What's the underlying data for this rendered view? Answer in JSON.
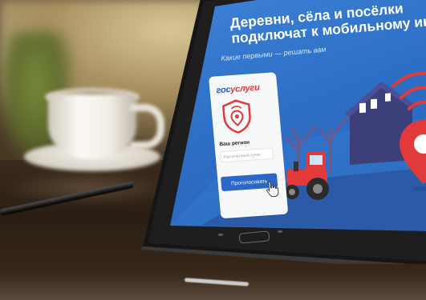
{
  "screen": {
    "headline_line1": "Деревни, сёла и посёлки",
    "headline_line2": "подключат к мобильному интернету",
    "subline": "Какие первыми — решать вам"
  },
  "card": {
    "logo_gos": "гос",
    "logo_uslugi": "услуги",
    "region_label": "Ваш регион",
    "region_placeholder": "Населённый пункт",
    "vote_button": "Проголосовать"
  },
  "colors": {
    "screen_blue": "#3f86d9",
    "brand_blue": "#2b5fb3",
    "brand_red": "#e23a3a",
    "button_blue": "#2b67c6"
  },
  "icons": {
    "shield": "wifi-pin-shield-icon",
    "pointer": "hand-pointer-icon",
    "signal": "wifi-signal-icon",
    "location": "location-pin-icon"
  }
}
